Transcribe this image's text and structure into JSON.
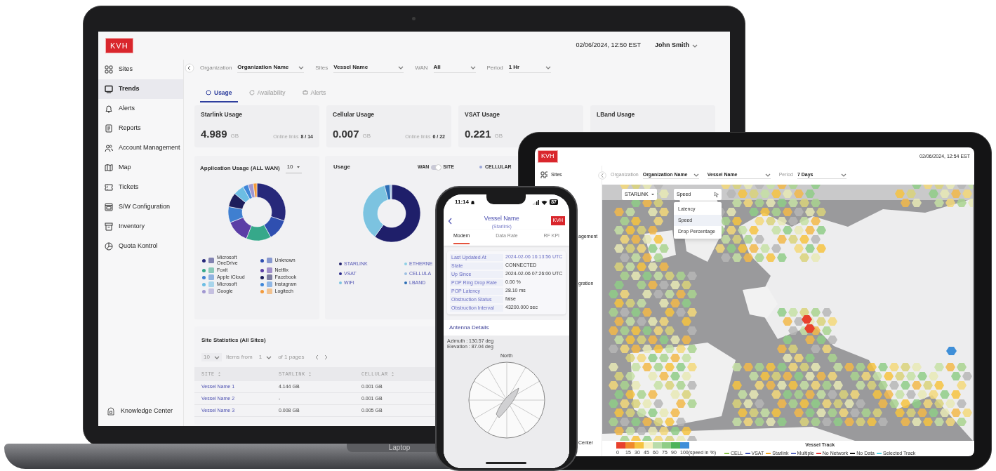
{
  "laptop": {
    "logo": "KVH",
    "datetime": "02/06/2024, 12:50 EST",
    "user": "John Smith",
    "sidebar": [
      {
        "label": "Sites",
        "selected": false
      },
      {
        "label": "Trends",
        "selected": true
      },
      {
        "label": "Alerts",
        "selected": false
      },
      {
        "label": "Reports",
        "selected": false
      },
      {
        "label": "Account Management",
        "selected": false
      },
      {
        "label": "Map",
        "selected": false
      },
      {
        "label": "Tickets",
        "selected": false
      },
      {
        "label": "S/W Configuration",
        "selected": false
      },
      {
        "label": "Inventory",
        "selected": false
      },
      {
        "label": "Quota Kontrol",
        "selected": false
      }
    ],
    "sidebar_footer": "Knowledge Center",
    "filters": [
      {
        "label": "Organization",
        "value": "Organization Name"
      },
      {
        "label": "Sites",
        "value": "Vessel Name"
      },
      {
        "label": "WAN",
        "value": "All"
      },
      {
        "label": "Period",
        "value": "1 Hr"
      }
    ],
    "tabs": [
      {
        "label": "Usage",
        "selected": true
      },
      {
        "label": "Availability",
        "selected": false
      },
      {
        "label": "Alerts",
        "selected": false
      }
    ],
    "cards": [
      {
        "title": "Starlink Usage",
        "value": "4.989",
        "unit": "GB",
        "online_label": "Online links",
        "online_count": "8 / 14"
      },
      {
        "title": "Cellular Usage",
        "value": "0.007",
        "unit": "GB",
        "online_label": "Online links",
        "online_count": "6 / 22"
      },
      {
        "title": "VSAT Usage",
        "value": "0.221",
        "unit": "GB"
      },
      {
        "title": "LBand Usage"
      }
    ],
    "app_usage": {
      "title": "Application Usage (ALL WAN)",
      "top_count": "10",
      "legend": [
        {
          "label": "Microsoft OneDrive",
          "color": "#27287a"
        },
        {
          "label": "Unknown",
          "color": "#2f4fb0"
        },
        {
          "label": "Foxit",
          "color": "#36a88a"
        },
        {
          "label": "Netflix",
          "color": "#5b3ea6"
        },
        {
          "label": "Apple iCloud",
          "color": "#3f7fd0"
        },
        {
          "label": "Facebook",
          "color": "#1d1e5c"
        },
        {
          "label": "Microsoft",
          "color": "#6cbde3"
        },
        {
          "label": "Instagram",
          "color": "#3f86d8"
        },
        {
          "label": "Google",
          "color": "#a097d0"
        },
        {
          "label": "Logitech",
          "color": "#f29a3c"
        }
      ]
    },
    "usage": {
      "title": "Usage",
      "toggle_left": "WAN",
      "toggle_right": "SITE",
      "site_view": true,
      "top_legend": [
        {
          "label": "CELLULAR",
          "color": "#9aa6d8"
        }
      ],
      "legend": [
        {
          "label": "STARLINK",
          "color": "#1f1f6a"
        },
        {
          "label": "ETHERNE",
          "color": "#8fd0e6"
        },
        {
          "label": "VSAT",
          "color": "#2b2b8c"
        },
        {
          "label": "CELLULA",
          "color": "#9fc0e2"
        },
        {
          "label": "WIFI",
          "color": "#7cc3e0"
        },
        {
          "label": "LBAND",
          "color": "#2c6db5"
        }
      ]
    },
    "site_stats": {
      "title": "Site Statistics (All Sites)",
      "page_size": "10",
      "items_from": "Items from",
      "page": "1",
      "of_pages": "of 1 pages",
      "columns": [
        "SITE",
        "STARLINK",
        "CELLULAR"
      ],
      "rows": [
        [
          "Vessel Name 1",
          "4.144 GB",
          "0.001 GB"
        ],
        [
          "Vessel Name 2",
          "-",
          "0.001 GB"
        ],
        [
          "Vessel Name 3",
          "0.008 GB",
          "0.005 GB"
        ]
      ]
    },
    "device_label": "Laptop"
  },
  "tablet": {
    "logo": "KVH",
    "datetime": "02/06/2024, 12:54 EST",
    "sidebar": [
      "Sites",
      "agement",
      "gration",
      "Center"
    ],
    "filters": [
      {
        "label": "Organization",
        "value": "Organization Name"
      },
      {
        "value": "Vessel Name"
      },
      {
        "label": "Period",
        "value": "7 Days"
      }
    ],
    "map_controls": [
      {
        "value": "STARLINK",
        "open": false
      },
      {
        "value": "Speed",
        "open": true
      }
    ],
    "menu": [
      {
        "label": "Latency",
        "selected": false
      },
      {
        "label": "Speed",
        "selected": true
      },
      {
        "label": "Drop Percentage",
        "selected": false
      }
    ],
    "scale": {
      "swatches": [
        {
          "color": "#e8412c"
        },
        {
          "color": "#f08a2c"
        },
        {
          "color": "#f6c341"
        },
        {
          "color": "#f7efc0"
        },
        {
          "color": "#b9dcaa"
        },
        {
          "color": "#8fcd87"
        },
        {
          "color": "#4eb35a"
        },
        {
          "color": "#3f8fd8"
        }
      ],
      "ticks": [
        "0",
        "15",
        "30",
        "45",
        "60",
        "75",
        "90",
        "100(speed in %)"
      ]
    },
    "track_legend": {
      "title": "Vessel Track",
      "items": [
        {
          "label": "CELL",
          "color": "#8bc34a"
        },
        {
          "label": "VSAT",
          "color": "#3f51b5"
        },
        {
          "label": "Starlink",
          "color": "#f5a623"
        },
        {
          "label": "Multiple",
          "color": "#5c6bc0"
        },
        {
          "label": "No Network",
          "color": "#e53935"
        },
        {
          "label": "No Data",
          "color": "#111111"
        },
        {
          "label": "Selected Track",
          "color": "#4dd0e1"
        }
      ]
    }
  },
  "phone": {
    "time": "11:14",
    "battery": "87",
    "title": "Vessel Name",
    "subtitle": "(Starlink)",
    "logo": "KVH",
    "tabs": [
      {
        "label": "Modem",
        "selected": true
      },
      {
        "label": "Data Rate",
        "selected": false
      },
      {
        "label": "RF KPI",
        "selected": false
      }
    ],
    "details": [
      {
        "label": "Last Updated At",
        "value": "2024-02-06 16:13:56 UTC",
        "highlight": true
      },
      {
        "label": "State",
        "value": "CONNECTED",
        "highlight": false
      },
      {
        "label": "Up Since",
        "value": "2024-02-06 07:26:00 UTC",
        "highlight": false
      },
      {
        "label": "POP Ring Drop Rate",
        "value": "0.00 %",
        "highlight": false
      },
      {
        "label": "POP Latency",
        "value": "28.10 ms",
        "highlight": false
      },
      {
        "label": "Obstruction Status",
        "value": "false",
        "highlight": false
      },
      {
        "label": "Obstruction Interval",
        "value": "43200.000 sec",
        "highlight": false
      }
    ],
    "antenna": {
      "title": "Antenna Details",
      "azimuth": "Azimuth : 130.57 deg",
      "elevation": "Elevation : 87.04 deg",
      "north": "North"
    }
  }
}
